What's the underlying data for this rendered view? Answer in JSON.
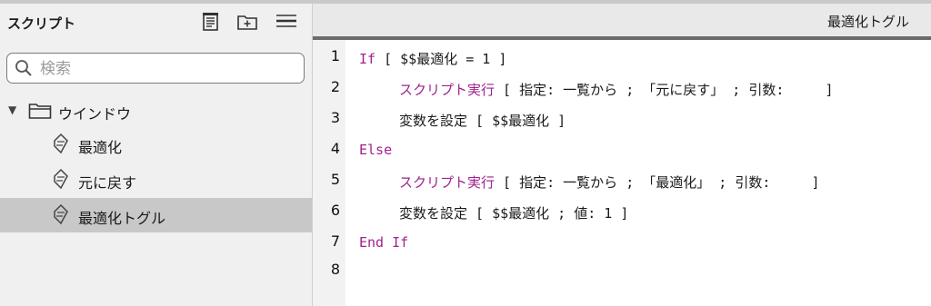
{
  "sidebar": {
    "title": "スクリプト",
    "search": {
      "placeholder": "検索",
      "value": ""
    },
    "folder": {
      "label": "ウインドウ"
    },
    "items": [
      {
        "label": "最適化"
      },
      {
        "label": "元に戻す"
      },
      {
        "label": "最適化トグル",
        "selected": true
      }
    ]
  },
  "editor": {
    "title": "最適化トグル",
    "lines": [
      {
        "num": "1",
        "kw": "If",
        "text": " [ $$最適化 = 1 ]"
      },
      {
        "num": "2",
        "kw": "スクリプト実行",
        "text": " [ 指定: 一覧から ; 「元に戻す」 ; 引数:     ]"
      },
      {
        "num": "3",
        "kw": "",
        "text": "変数を設定 [ $$最適化 ]"
      },
      {
        "num": "4",
        "kw": "Else",
        "text": ""
      },
      {
        "num": "5",
        "kw": "スクリプト実行",
        "text": " [ 指定: 一覧から ; 「最適化」 ; 引数:     ]"
      },
      {
        "num": "6",
        "kw": "",
        "text": "変数を設定 [ $$最適化 ; 値: 1 ]"
      },
      {
        "num": "7",
        "kw": "End If",
        "text": ""
      },
      {
        "num": "8",
        "kw": "",
        "text": ""
      }
    ]
  },
  "colors": {
    "keyword": "#a0228f",
    "selection": "#c8c8c8",
    "header_bg": "#e9e9e9"
  }
}
